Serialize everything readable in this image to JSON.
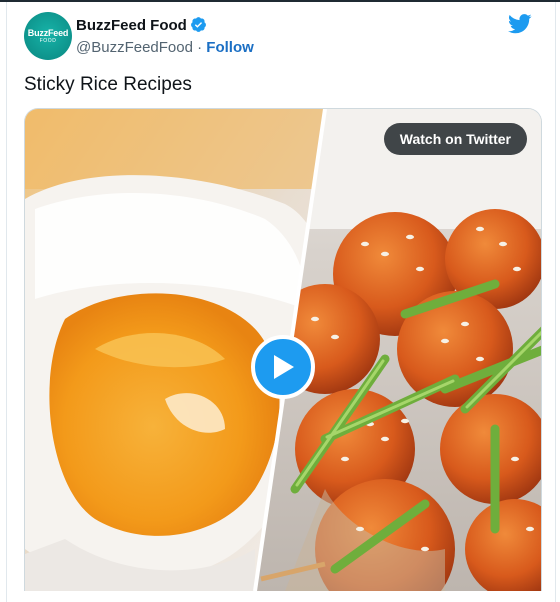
{
  "account": {
    "avatar_text_top": "BuzzFeed",
    "avatar_text_bottom": "FOOD",
    "display_name": "BuzzFeed Food",
    "handle": "@BuzzFeedFood",
    "separator": "·",
    "follow_label": "Follow",
    "verified": true
  },
  "tweet": {
    "text": "Sticky Rice Recipes"
  },
  "media": {
    "watch_label": "Watch on Twitter",
    "play_icon": "play-icon"
  },
  "colors": {
    "twitter_blue": "#1d9bf0",
    "follow_link": "#1b6fc4",
    "avatar_teal": "#12a59b"
  }
}
